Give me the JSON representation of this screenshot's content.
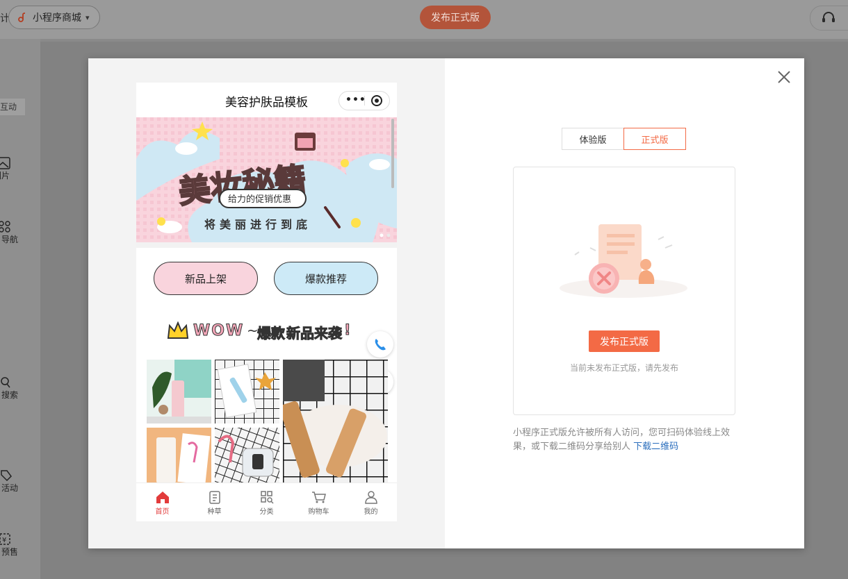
{
  "topbar": {
    "left_fragment": "计",
    "app_pill_label": "小程序商城",
    "publish_label": "发布正式版"
  },
  "sidebar": {
    "tag": "互动",
    "items": [
      {
        "label": "图片",
        "icon": "image-icon"
      },
      {
        "label": "导航",
        "icon": "grid-icon"
      },
      {
        "label": "搜索",
        "icon": "search-icon"
      },
      {
        "label": "活动",
        "icon": "tag-icon"
      },
      {
        "label": "预售",
        "icon": "presale-icon"
      }
    ]
  },
  "phone": {
    "title": "美容护肤品模板",
    "banner": {
      "headline": "美妆秘籍",
      "badge": "给力的促销优惠",
      "slogan": "将美丽进行到底"
    },
    "buttons": [
      "新品上架",
      "爆款推荐"
    ],
    "promo": {
      "wow": "WOW",
      "tilde": "~",
      "hot": "爆款",
      "new": "新品来袭",
      "bang": "!"
    },
    "tabs": [
      {
        "label": "首页",
        "icon": "home-icon",
        "active": true
      },
      {
        "label": "种草",
        "icon": "clipboard-icon",
        "active": false
      },
      {
        "label": "分类",
        "icon": "category-icon",
        "active": false
      },
      {
        "label": "购物车",
        "icon": "cart-icon",
        "active": false
      },
      {
        "label": "我的",
        "icon": "user-icon",
        "active": false
      }
    ],
    "colors": {
      "pink": "#f9d4dd",
      "blue": "#cdeaf7",
      "accent": "#e23b3b"
    }
  },
  "panel": {
    "segments": [
      "体验版",
      "正式版"
    ],
    "selected_segment": "正式版",
    "publish_button": "发布正式版",
    "empty_hint": "当前未发布正式版，请先发布",
    "note": "小程序正式版允许被所有人访问，您可扫码体验线上效果，或下载二维码分享给别人",
    "download_link": "下载二维码",
    "accent": "#f36a45"
  }
}
